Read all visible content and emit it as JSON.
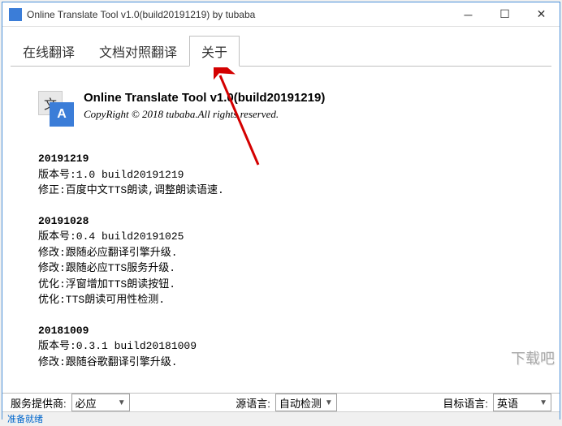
{
  "window": {
    "title": "Online Translate Tool v1.0(build20191219) by tubaba"
  },
  "tabs": {
    "items": [
      {
        "label": "在线翻译"
      },
      {
        "label": "文档对照翻译"
      },
      {
        "label": "关于"
      }
    ],
    "active_index": 2
  },
  "about": {
    "title": "Online Translate Tool v1.0(build20191219)",
    "copyright": "CopyRight © 2018 tubaba.All rights reserved.",
    "icon_back_char": "文",
    "icon_front_char": "A",
    "changelog": [
      {
        "date": "20191219",
        "lines": [
          "版本号:1.0 build20191219",
          "修正:百度中文TTS朗读,调整朗读语速."
        ]
      },
      {
        "date": "20191028",
        "lines": [
          "版本号:0.4 build20191025",
          "修改:跟随必应翻译引擎升级.",
          "修改:跟随必应TTS服务升级.",
          "优化:浮窗增加TTS朗读按钮.",
          "优化:TTS朗读可用性检测."
        ]
      },
      {
        "date": "20181009",
        "lines": [
          "版本号:0.3.1 build20181009",
          "修改:跟随谷歌翻译引擎升级."
        ]
      }
    ]
  },
  "bottom": {
    "provider_label": "服务提供商:",
    "provider_value": "必应",
    "source_label": "源语言:",
    "source_value": "自动检测",
    "target_label": "目标语言:",
    "target_value": "英语"
  },
  "status": "准备就绪",
  "watermark": "下载吧"
}
